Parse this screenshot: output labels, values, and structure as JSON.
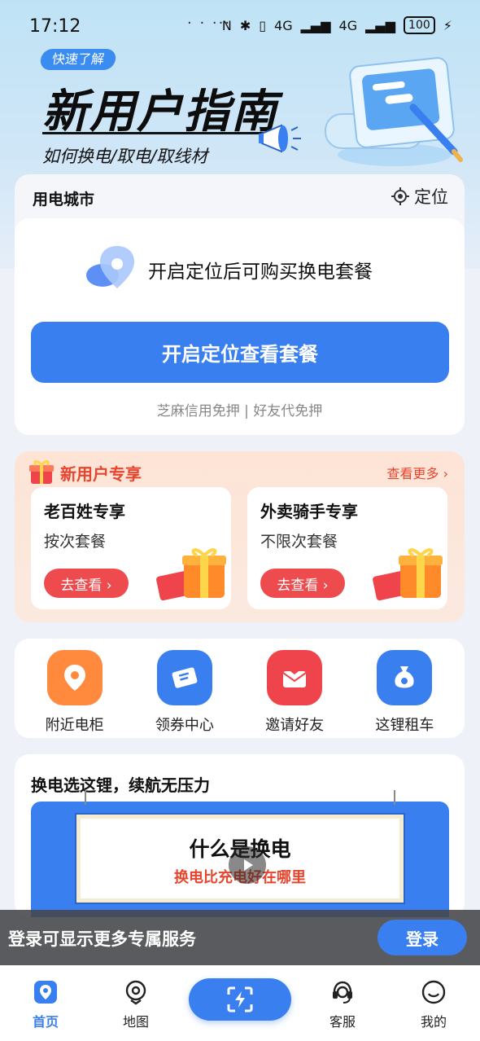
{
  "status_bar": {
    "time": "17:12",
    "dots": "· · ···",
    "signal_1": "4G",
    "signal_2": "4G",
    "battery": "100"
  },
  "banner": {
    "pill": "快速了解",
    "title": "新用户指南",
    "subtitle": "如何换电/取电/取线材"
  },
  "city": {
    "label": "用电城市",
    "locate": "定位",
    "message": "开启定位后可购买换电套餐",
    "button": "开启定位查看套餐",
    "deposit_1": "芝麻信用免押",
    "separator": " | ",
    "deposit_2": "好友代免押"
  },
  "new_user": {
    "title": "新用户专享",
    "more": "查看更多 ›",
    "cards": [
      {
        "title": "老百姓专享",
        "subtitle": "按次套餐",
        "button": "去查看 ›"
      },
      {
        "title": "外卖骑手专享",
        "subtitle": "不限次套餐",
        "button": "去查看 ›"
      }
    ]
  },
  "quick_grid": [
    {
      "label": "附近电柜",
      "icon": "location-pin-icon",
      "color": "#ff8a3d"
    },
    {
      "label": "领券中心",
      "icon": "ticket-icon",
      "color": "#3a7ff0"
    },
    {
      "label": "邀请好友",
      "icon": "envelope-heart-icon",
      "color": "#f0444c"
    },
    {
      "label": "这锂租车",
      "icon": "money-bag-icon",
      "color": "#3a7ff0"
    }
  ],
  "video": {
    "title": "换电选这锂，续航无压力",
    "heading": "什么是换电",
    "caption": "换电比充电好在哪里"
  },
  "login_bar": {
    "text": "登录可显示更多专属服务",
    "button": "登录"
  },
  "tabbar": {
    "home": "首页",
    "map": "地图",
    "service": "客服",
    "mine": "我的"
  },
  "colors": {
    "accent": "#3a7ff0",
    "promo": "#e8452e"
  }
}
